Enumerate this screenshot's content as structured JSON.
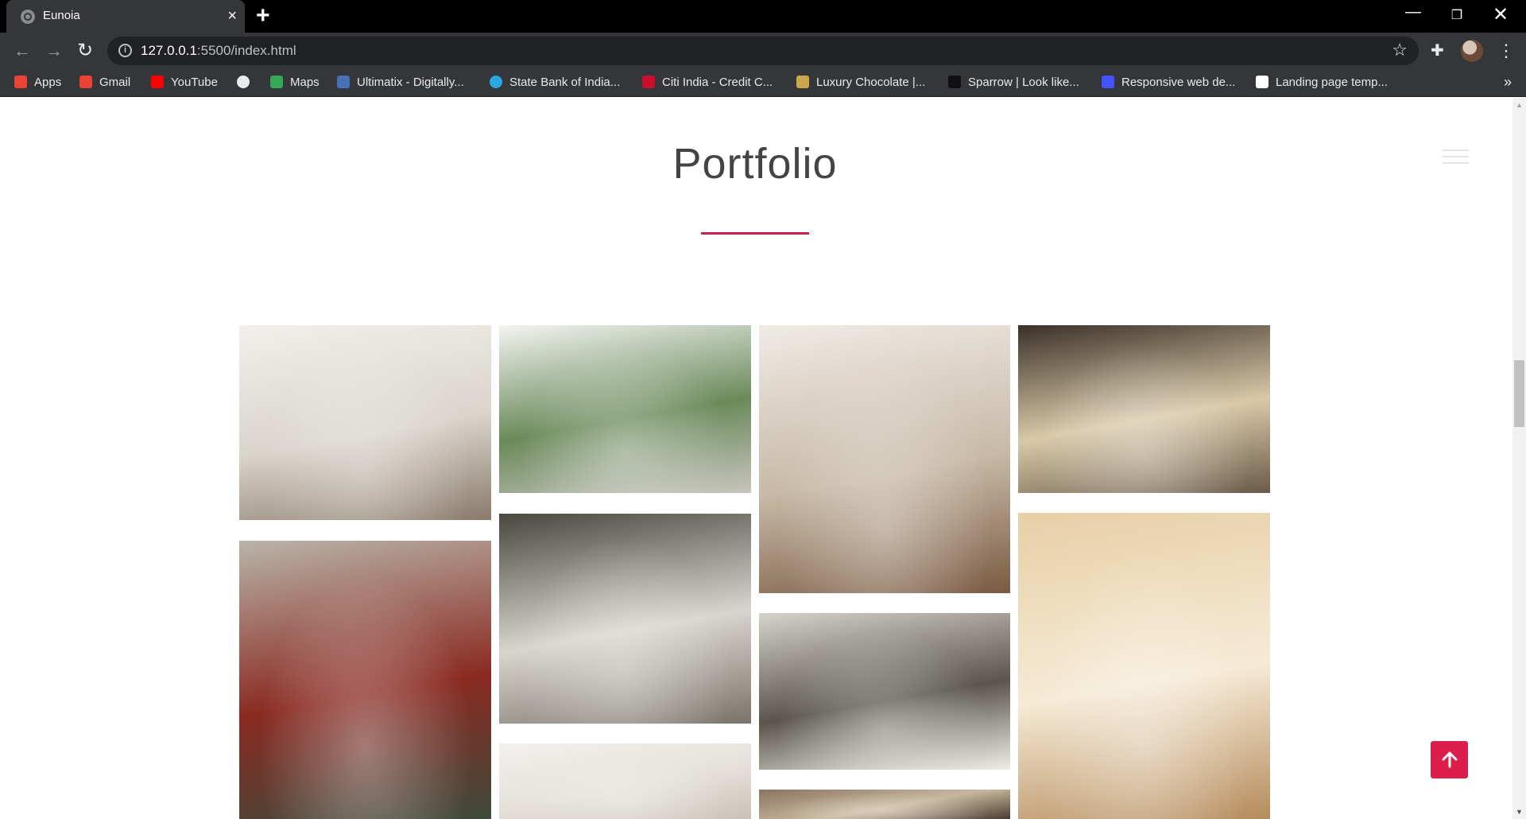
{
  "browser": {
    "tab_title": "Eunoia",
    "url_host": "127.0.0.1",
    "url_rest": ":5500/index.html",
    "bookmarks": [
      {
        "label": "Apps",
        "icon": "apps-grid-icon",
        "color": "#ea4335"
      },
      {
        "label": "Gmail",
        "icon": "gmail-icon",
        "color": "#ea4335"
      },
      {
        "label": "YouTube",
        "icon": "youtube-icon",
        "color": "#ff0000"
      },
      {
        "label": "",
        "icon": "globe-icon",
        "color": "#e8eaed"
      },
      {
        "label": "Maps",
        "icon": "maps-icon",
        "color": "#34a853"
      },
      {
        "label": "Ultimatix - Digitally...",
        "icon": "ultimatix-icon",
        "color": "#4a6fb5"
      },
      {
        "label": "State Bank of India...",
        "icon": "sbi-icon",
        "color": "#29a8e0"
      },
      {
        "label": "Citi India - Credit C...",
        "icon": "citi-icon",
        "color": "#c8102e"
      },
      {
        "label": "Luxury Chocolate |...",
        "icon": "luxury-chocolate-icon",
        "color": "#c9a84c"
      },
      {
        "label": "Sparrow | Look like...",
        "icon": "sparrow-icon",
        "color": "#111111"
      },
      {
        "label": "Responsive web de...",
        "icon": "webflow-w-icon",
        "color": "#4353ff"
      },
      {
        "label": "Landing page temp...",
        "icon": "w-icon",
        "color": "#ffffff"
      }
    ]
  },
  "page": {
    "section_title": "Portfolio",
    "accent_color": "#dc1e4b"
  },
  "gallery": [
    {
      "name": "white-living-room-art",
      "colors": [
        "#f2f0ec",
        "#d9d4cc",
        "#8a7a6a"
      ]
    },
    {
      "name": "open-villa-lounge",
      "colors": [
        "#f4f4f2",
        "#6a8a5a",
        "#c8c4be"
      ]
    },
    {
      "name": "chandelier-fireplace-lounge",
      "colors": [
        "#efebe6",
        "#c7b9a6",
        "#7a5a42"
      ]
    },
    {
      "name": "glass-atrium-hall",
      "colors": [
        "#3a3128",
        "#d9c8a8",
        "#6a5a48"
      ]
    },
    {
      "name": "flowering-tree-courtyard",
      "colors": [
        "#b9b4a8",
        "#8a2a22",
        "#3e4a3a"
      ]
    },
    {
      "name": "floral-mural-bedroom",
      "colors": [
        "#4a4640",
        "#d8d4ce",
        "#7a736a"
      ]
    },
    {
      "name": "grey-lounge-fireplace",
      "colors": [
        "#d6d2cc",
        "#5a554e",
        "#f0ede8"
      ]
    },
    {
      "name": "golden-dining-room",
      "colors": [
        "#e7cfa6",
        "#f6ead6",
        "#b58c5c"
      ]
    },
    {
      "name": "bright-white-atrium",
      "colors": [
        "#f3f1ee",
        "#e5e0da",
        "#c9c2b8"
      ]
    },
    {
      "name": "spotlit-ceiling-hall",
      "colors": [
        "#8a7460",
        "#c8b79c",
        "#4a3e32"
      ]
    }
  ]
}
